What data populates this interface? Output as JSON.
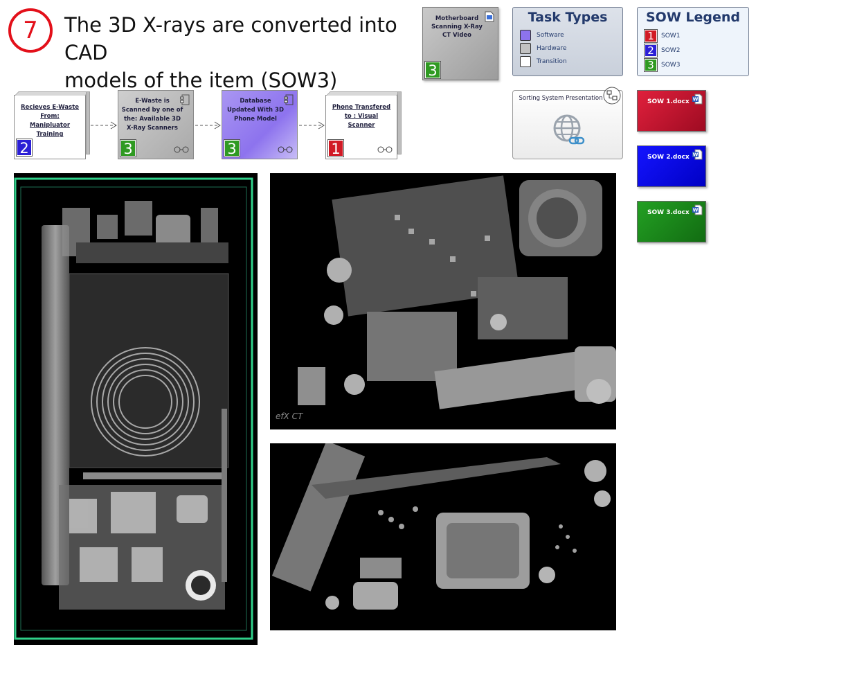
{
  "step": {
    "number": "7",
    "color": "#e3101a"
  },
  "headline": {
    "line1": "The 3D X-rays are converted into CAD",
    "line2": "models of the item (SOW3)"
  },
  "video_artifact": {
    "label": "Motherboard Scanning X-Ray CT Video",
    "sow": "3"
  },
  "task_types": {
    "title": "Task Types",
    "items": [
      {
        "label": "Software",
        "color": "#8d73ee"
      },
      {
        "label": "Hardware",
        "color": "#c2c2c2"
      },
      {
        "label": "Transition",
        "color": "#ffffff"
      }
    ]
  },
  "sow_legend": {
    "title": "SOW Legend",
    "items": [
      {
        "number": "1",
        "label": "SOW1",
        "color": "#d11a25"
      },
      {
        "number": "2",
        "label": "SOW2",
        "color": "#2b1fd6"
      },
      {
        "number": "3",
        "label": "SOW3",
        "color": "#2f9a22"
      }
    ]
  },
  "flow": [
    {
      "label": "Recieves E-Waste From: Manipluator Training",
      "sow": "2",
      "type": "Transition"
    },
    {
      "label": "E-Waste is Scanned by one of the: Available 3D X-Ray Scanners",
      "sow": "3",
      "type": "Hardware"
    },
    {
      "label": "Database Updated With 3D Phone Model",
      "sow": "3",
      "type": "Software"
    },
    {
      "label": "Phone Transfered to : Visual Scanner",
      "sow": "1",
      "type": "Transition"
    }
  ],
  "presentation": {
    "label": "Sorting System Presentation"
  },
  "documents": [
    {
      "label": "SOW 1.docx",
      "color": "#c8102e"
    },
    {
      "label": "SOW 2.docx",
      "color": "#0a0ae6"
    },
    {
      "label": "SOW 3.docx",
      "color": "#1e8a1e"
    }
  ],
  "images": {
    "watermark": "efX CT"
  }
}
